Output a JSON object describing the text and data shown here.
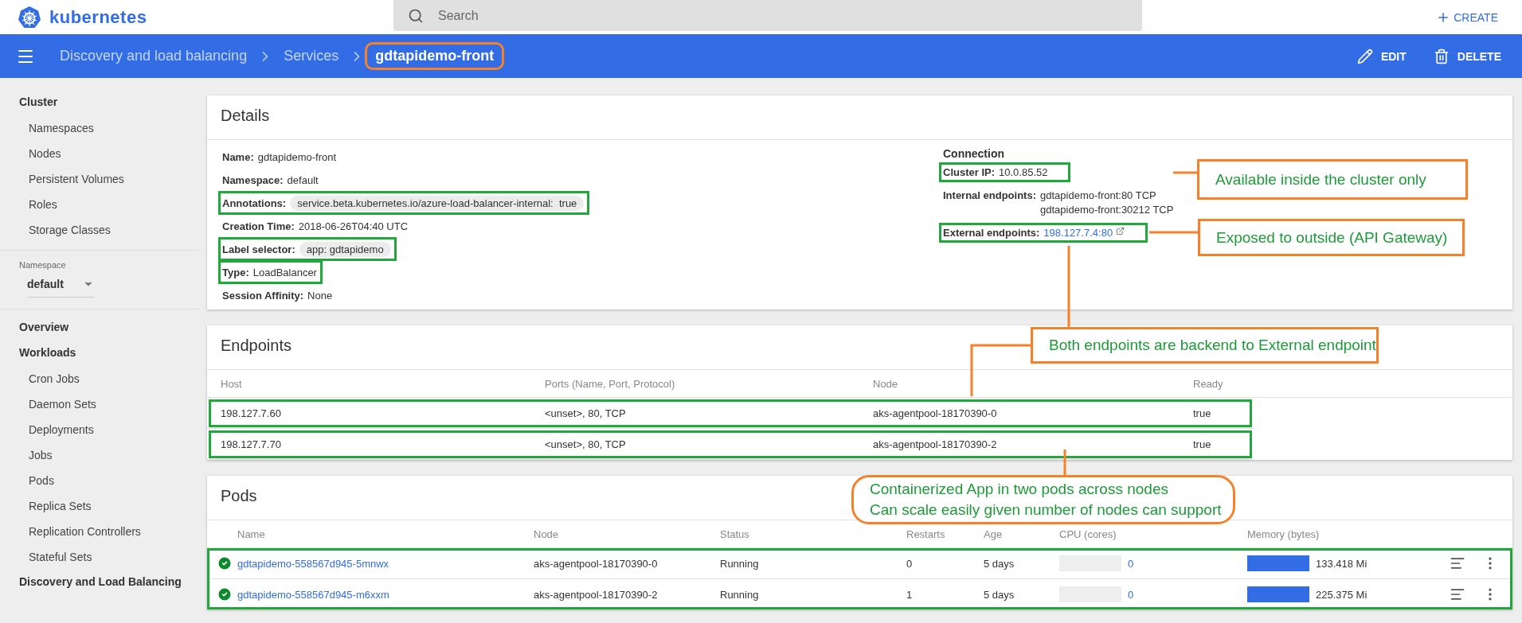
{
  "header": {
    "logo_text": "kubernetes",
    "search": {
      "placeholder": "Search"
    },
    "create_label": "CREATE"
  },
  "toolbar": {
    "breadcrumbs": [
      {
        "label": "Discovery and load balancing",
        "current": false,
        "highlighted": false
      },
      {
        "label": "Services",
        "current": false,
        "highlighted": false
      },
      {
        "label": "gdtapidemo-front",
        "current": true,
        "highlighted": true
      }
    ],
    "actions": [
      {
        "kind": "edit",
        "label": "EDIT"
      },
      {
        "kind": "delete",
        "label": "DELETE"
      }
    ]
  },
  "sidebar": {
    "sections": [
      {
        "title": "Cluster",
        "items": [
          "Namespaces",
          "Nodes",
          "Persistent Volumes",
          "Roles",
          "Storage Classes"
        ]
      },
      {
        "kind": "namespace",
        "label": "Namespace",
        "value": "default"
      },
      {
        "title": "Overview"
      },
      {
        "title": "Workloads",
        "items": [
          "Cron Jobs",
          "Daemon Sets",
          "Deployments",
          "Jobs",
          "Pods",
          "Replica Sets",
          "Replication Controllers",
          "Stateful Sets"
        ]
      },
      {
        "title": "Discovery and Load Balancing"
      }
    ]
  },
  "details": {
    "title": "Details",
    "fields": [
      {
        "label": "Name:",
        "value": "gdtapidemo-front",
        "kind": "text",
        "highlighted": false
      },
      {
        "label": "Namespace:",
        "value": "default",
        "kind": "text",
        "highlighted": false
      },
      {
        "label": "Annotations:",
        "value": "service.beta.kubernetes.io/azure-load-balancer-internal:  true",
        "kind": "chip",
        "highlighted": true
      },
      {
        "label": "Creation Time:",
        "value": "2018-06-26T04:40 UTC",
        "kind": "text",
        "highlighted": false
      },
      {
        "label": "Label selector:",
        "value": "app: gdtapidemo",
        "kind": "chip",
        "highlighted": true
      },
      {
        "label": "Type:",
        "value": "LoadBalancer",
        "kind": "text",
        "highlighted": true
      },
      {
        "label": "Session Affinity:",
        "value": "None",
        "kind": "text",
        "highlighted": false
      }
    ],
    "connection": {
      "title": "Connection",
      "fields": [
        {
          "label": "Cluster IP:",
          "values": [
            "10.0.85.52"
          ],
          "kind": "text",
          "highlighted": true
        },
        {
          "label": "Internal endpoints:",
          "values": [
            "gdtapidemo-front:80 TCP",
            "gdtapidemo-front:30212 TCP"
          ],
          "kind": "text",
          "highlighted": false
        },
        {
          "label": "External endpoints:",
          "values": [
            "198.127.7.4:80"
          ],
          "kind": "link",
          "highlighted": true
        }
      ]
    }
  },
  "endpoints": {
    "title": "Endpoints",
    "columns": [
      "Host",
      "Ports (Name, Port, Protocol)",
      "Node",
      "Ready"
    ],
    "rows": [
      {
        "cells": [
          "198.127.7.60",
          "<unset>, 80, TCP",
          "aks-agentpool-18170390-0",
          "true"
        ],
        "highlighted": true
      },
      {
        "cells": [
          "198.127.7.70",
          "<unset>, 80, TCP",
          "aks-agentpool-18170390-2",
          "true"
        ],
        "highlighted": true
      }
    ]
  },
  "pods": {
    "title": "Pods",
    "highlighted": true,
    "columns": [
      "Name",
      "Node",
      "Status",
      "Restarts",
      "Age",
      "CPU (cores)",
      "Memory (bytes)"
    ],
    "rows": [
      {
        "name": "gdtapidemo-558567d945-5mnwx",
        "node": "aks-agentpool-18170390-0",
        "status": "Running",
        "restarts": "0",
        "age": "5 days",
        "cpu": {
          "level": 0,
          "reading": "0"
        },
        "memory": {
          "level": 1,
          "reading": "133.418 Mi"
        }
      },
      {
        "name": "gdtapidemo-558567d945-m6xxm",
        "node": "aks-agentpool-18170390-2",
        "status": "Running",
        "restarts": "1",
        "age": "5 days",
        "cpu": {
          "level": 0,
          "reading": "0"
        },
        "memory": {
          "level": 1,
          "reading": "225.375 Mi"
        }
      }
    ]
  },
  "annotations": [
    {
      "text": "Available inside the cluster only",
      "kind": "box"
    },
    {
      "text": "Exposed to outside (API Gateway)",
      "kind": "box"
    },
    {
      "text": "Both endpoints are backend to External endpoint",
      "kind": "box"
    },
    {
      "text": "Containerized App in two pods across nodes\nCan scale easily given number of nodes can support",
      "kind": "rounded"
    }
  ]
}
